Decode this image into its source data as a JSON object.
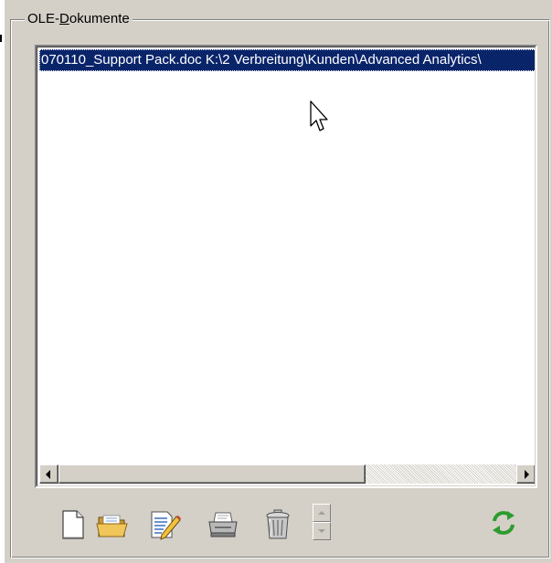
{
  "group": {
    "label_prefix": "OLE-",
    "label_mnemonic": "D",
    "label_rest": "okumente"
  },
  "list": {
    "items": [
      {
        "text": "070110_Support Pack.doc K:\\2 Verbreitung\\Kunden\\Advanced Analytics\\",
        "selected": true
      }
    ]
  },
  "toolbar": {
    "buttons": [
      {
        "name": "new-document-button",
        "icon": "new-document-icon"
      },
      {
        "name": "open-folder-button",
        "icon": "open-folder-icon"
      },
      {
        "name": "edit-document-button",
        "icon": "edit-document-icon"
      },
      {
        "name": "print-button",
        "icon": "printer-icon"
      },
      {
        "name": "delete-button",
        "icon": "trash-icon"
      },
      {
        "name": "refresh-button",
        "icon": "refresh-icon"
      }
    ]
  },
  "colors": {
    "face": "#d4d0c8",
    "selection": "#0a246a",
    "refresh_green": "#2e9b2e"
  }
}
